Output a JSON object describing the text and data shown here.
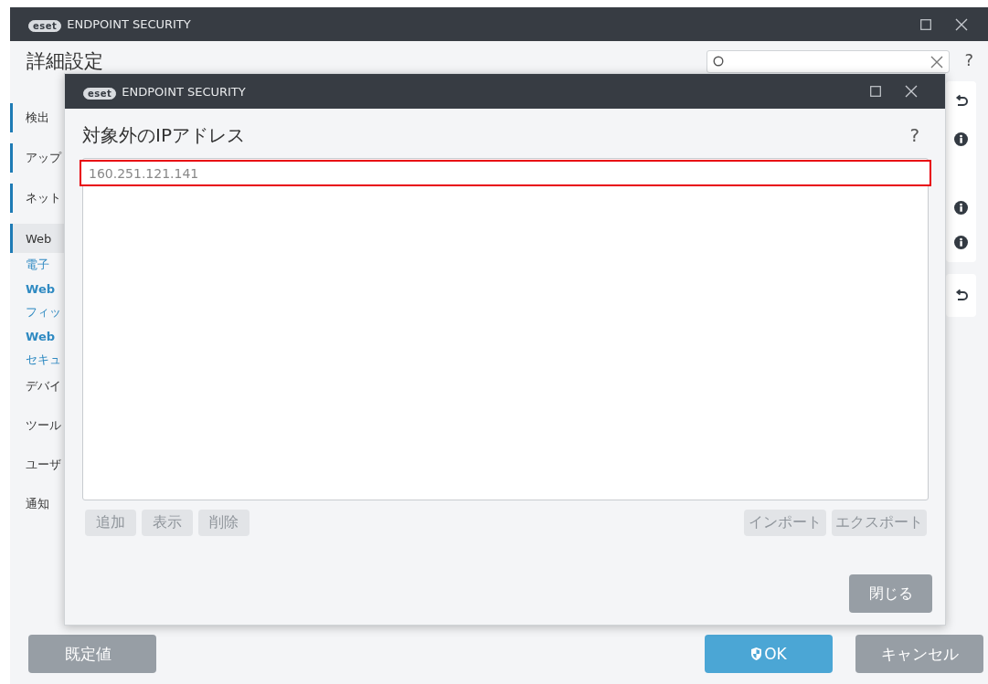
{
  "window": {
    "logo": "eset",
    "title": "ENDPOINT SECURITY",
    "heading": "詳細設定",
    "help": "?"
  },
  "sidebar": {
    "items": [
      {
        "label": "検出",
        "kind": "category",
        "selected": false
      },
      {
        "label": "アップ",
        "kind": "category",
        "selected": false
      },
      {
        "label": "ネット",
        "kind": "category",
        "selected": false
      },
      {
        "label": "Web",
        "kind": "category",
        "selected": true
      },
      {
        "label": "電子",
        "kind": "sub",
        "selected": false
      },
      {
        "label": "Web",
        "kind": "sub-bold",
        "selected": false
      },
      {
        "label": "フィッ",
        "kind": "sub",
        "selected": false
      },
      {
        "label": "Web",
        "kind": "sub-bold",
        "selected": false
      },
      {
        "label": "セキュ",
        "kind": "sub",
        "selected": false
      },
      {
        "label": "デバイ",
        "kind": "plain",
        "selected": false
      },
      {
        "label": "ツール",
        "kind": "plain",
        "selected": false
      },
      {
        "label": "ユーザ",
        "kind": "plain",
        "selected": false
      },
      {
        "label": "通知",
        "kind": "plain",
        "selected": false
      }
    ]
  },
  "dialog": {
    "logo": "eset",
    "title": "ENDPOINT SECURITY",
    "heading": "対象外のIPアドレス",
    "help": "?",
    "rows": [
      {
        "text": "160.251.121.141",
        "selected": true
      }
    ],
    "left_buttons": [
      {
        "label": "追加",
        "disabled": true
      },
      {
        "label": "表示",
        "disabled": true
      },
      {
        "label": "削除",
        "disabled": true
      }
    ],
    "right_buttons": [
      {
        "label": "インポート",
        "disabled": true
      },
      {
        "label": "エクスポート",
        "disabled": true
      }
    ],
    "close_button": "閉じる"
  },
  "footer": {
    "default_button": "既定値",
    "ok_button": "OK",
    "cancel_button": "キャンセル"
  }
}
